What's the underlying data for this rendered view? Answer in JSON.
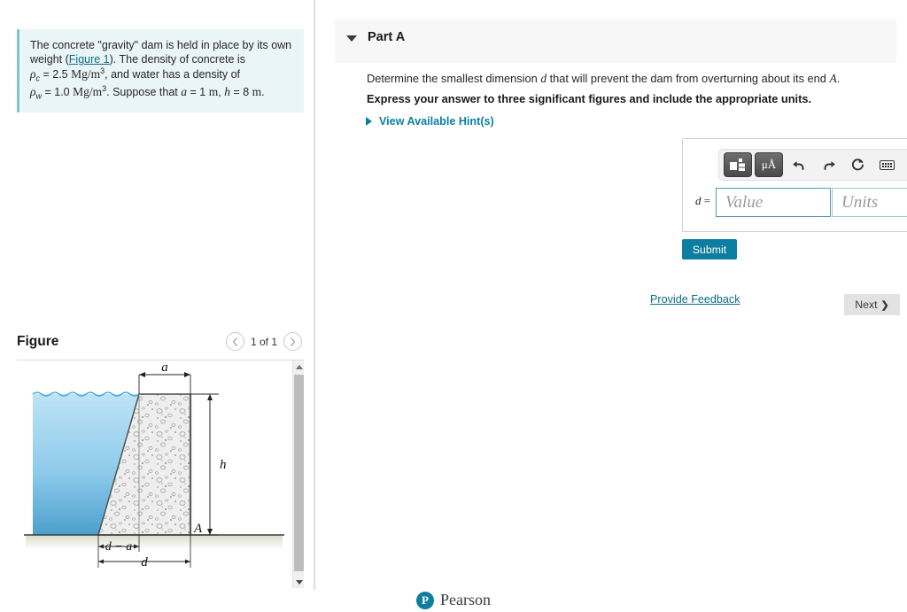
{
  "problem": {
    "line1": "The concrete \"gravity\" dam is held in place by its own",
    "line2_pre": "weight (",
    "figure_link": "Figure 1",
    "line2_post": "). The density of concrete is",
    "rho_c_symbol": "ρ",
    "rho_c_sub": "c",
    "rho_c_value": "= 2.5",
    "rho_c_units": "Mg/m",
    "rho_exp": "3",
    "line3_post": ", and water has a density of",
    "rho_w_symbol": "ρ",
    "rho_w_sub": "w",
    "rho_w_value": "= 1.0",
    "rho_w_units": "Mg/m",
    "suppose_text": ". Suppose that",
    "a_symbol": "a",
    "a_value": "= 1",
    "a_units": "m",
    "comma": ",",
    "h_symbol": "h",
    "h_value": "= 8",
    "h_units": "m",
    "period": "."
  },
  "figure": {
    "title": "Figure",
    "count_label": "1 of 1",
    "prev_icon": "chevron-left-icon",
    "next_icon": "chevron-right-icon",
    "labels": {
      "a": "a",
      "h": "h",
      "A": "A",
      "d_minus_a": "d − a",
      "d": "d"
    }
  },
  "part": {
    "caret_icon": "caret-down-icon",
    "title": "Part A",
    "question_pre": "Determine the smallest dimension ",
    "question_var_d": "d",
    "question_mid": " that will prevent the dam from overturning about its end ",
    "question_var_A": "A",
    "question_end": ".",
    "instruction": "Express your answer to three significant figures and include the appropriate units.",
    "hint_label": "View Available Hint(s)",
    "hint_caret_icon": "caret-right-icon"
  },
  "answer": {
    "toolbar": [
      {
        "name": "template-button",
        "icon": "math-template-icon",
        "label": ""
      },
      {
        "name": "units-button",
        "icon": "micro-angstrom-icon",
        "label": "μÅ"
      },
      {
        "name": "undo-button",
        "icon": "undo-arrow-icon",
        "label": "↩"
      },
      {
        "name": "redo-button",
        "icon": "redo-arrow-icon",
        "label": "↪"
      },
      {
        "name": "reset-button",
        "icon": "reset-circle-icon",
        "label": "↻"
      },
      {
        "name": "keyboard-button",
        "icon": "keyboard-icon",
        "label": ""
      },
      {
        "name": "help-button",
        "icon": "question-mark-icon",
        "label": "?"
      }
    ],
    "equals_var": "d",
    "equals_sign": "=",
    "value_placeholder": "Value",
    "value_text": "",
    "units_placeholder": "Units",
    "units_text": ""
  },
  "actions": {
    "submit_label": "Submit",
    "feedback_label": "Provide Feedback",
    "next_label": "Next",
    "next_icon": "chevron-right-icon"
  },
  "footer": {
    "logo_letter": "P",
    "brand": "Pearson"
  },
  "colors": {
    "accent_teal": "#0d7ea0",
    "problem_bg": "#e9f5f6",
    "problem_border": "#7fc4cf",
    "part_header_bg": "#f7f7f7",
    "field_border": "#4f98aa",
    "next_bg": "#e2e2e2",
    "water_top": "#bde3f5",
    "water_bottom": "#4fa8d8",
    "concrete": "#eeeeee"
  }
}
